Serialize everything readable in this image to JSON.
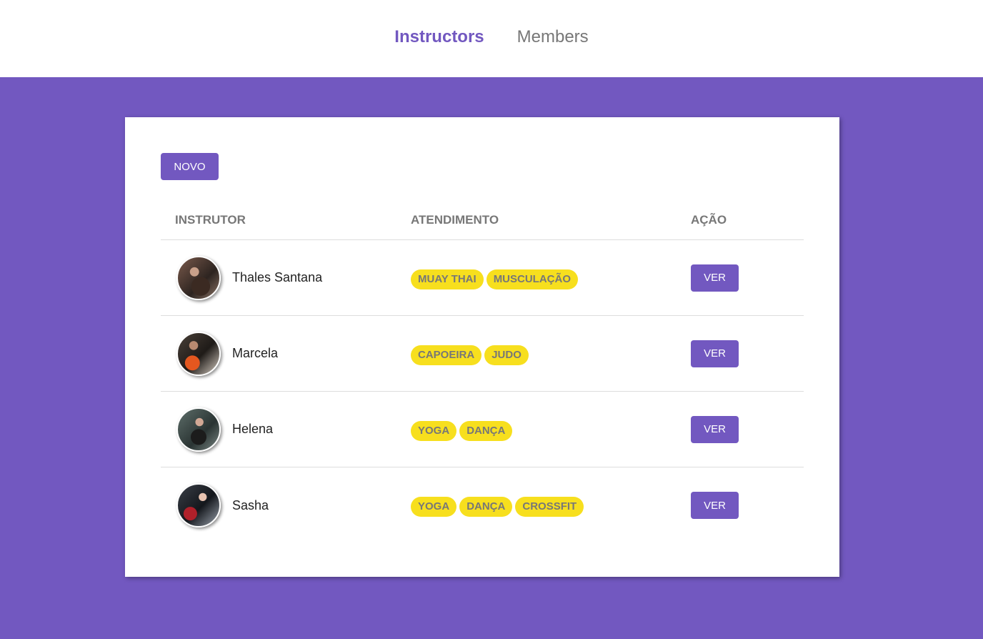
{
  "nav": {
    "items": [
      {
        "label": "Instructors",
        "active": true
      },
      {
        "label": "Members",
        "active": false
      }
    ]
  },
  "colors": {
    "brand": "#7258c0",
    "tag": "#f7df1e"
  },
  "card": {
    "new_button_label": "Novo",
    "table": {
      "headers": [
        "Instrutor",
        "Atendimento",
        "Ação"
      ],
      "rows": [
        {
          "name": "Thales Santana",
          "avatar_icon": "avatar-photo",
          "services": [
            "Muay Thai",
            "Musculação"
          ],
          "action_label": "Ver"
        },
        {
          "name": "Marcela",
          "avatar_icon": "avatar-photo",
          "services": [
            "Capoeira",
            "Judo"
          ],
          "action_label": "Ver"
        },
        {
          "name": "Helena",
          "avatar_icon": "avatar-photo",
          "services": [
            "Yoga",
            "Dança"
          ],
          "action_label": "Ver"
        },
        {
          "name": "Sasha",
          "avatar_icon": "avatar-photo",
          "services": [
            "Yoga",
            "Dança",
            "Crossfit"
          ],
          "action_label": "Ver"
        }
      ]
    }
  }
}
